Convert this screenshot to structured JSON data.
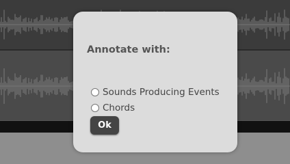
{
  "dialog": {
    "title": "Annotate with:",
    "options": [
      {
        "label": "Sounds Producing Events",
        "selected": false
      },
      {
        "label": "Chords",
        "selected": false
      }
    ],
    "ok_label": "Ok"
  },
  "colors": {
    "dialog_bg": "#dcdcdc",
    "button_bg": "#444444",
    "waveform": "#6e6e6e"
  }
}
